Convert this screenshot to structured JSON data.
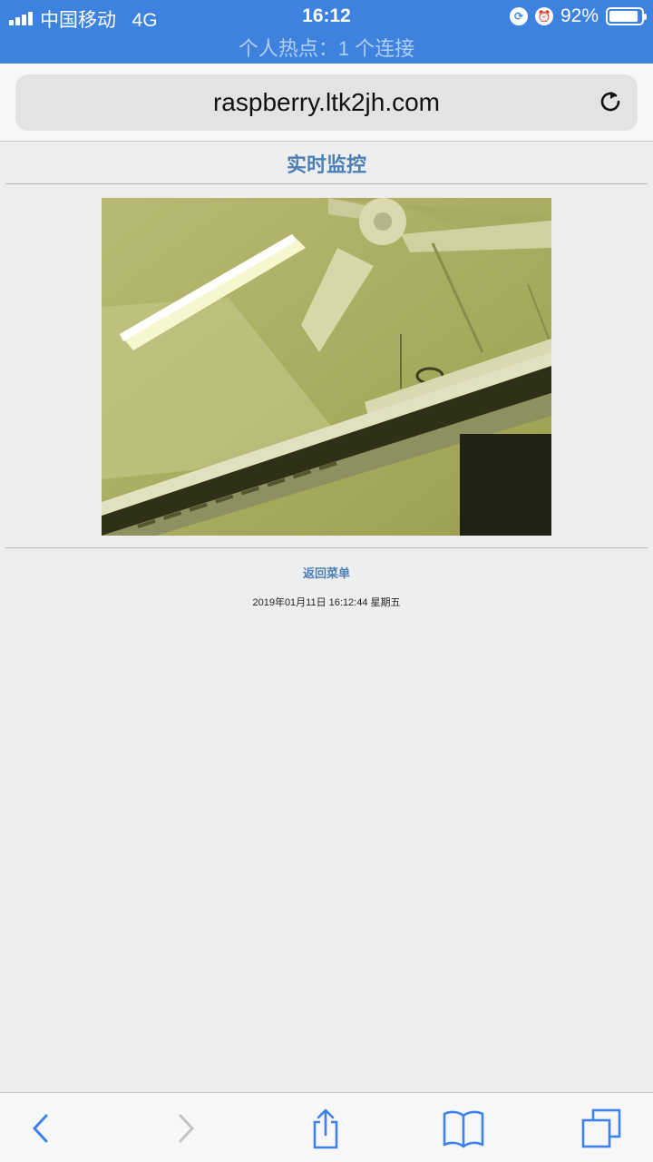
{
  "status": {
    "carrier": "中国移动",
    "network": "4G",
    "time": "16:12",
    "battery_percent": "92%",
    "battery_level": 0.92,
    "hotspot_text": "个人热点：1 个连接",
    "bar_color": "#3e82e0"
  },
  "browser": {
    "url": "raspberry.ltk2jh.com",
    "reload_icon": "reload-icon"
  },
  "page": {
    "title": "实时监控",
    "back_link": "返回菜单",
    "timestamp": "2019年01月11日 16:12:44 星期五",
    "accent_color": "#4a7fb5"
  },
  "toolbar": {
    "items": [
      "back-icon",
      "forward-icon",
      "share-icon",
      "bookmarks-icon",
      "tabs-icon"
    ]
  }
}
